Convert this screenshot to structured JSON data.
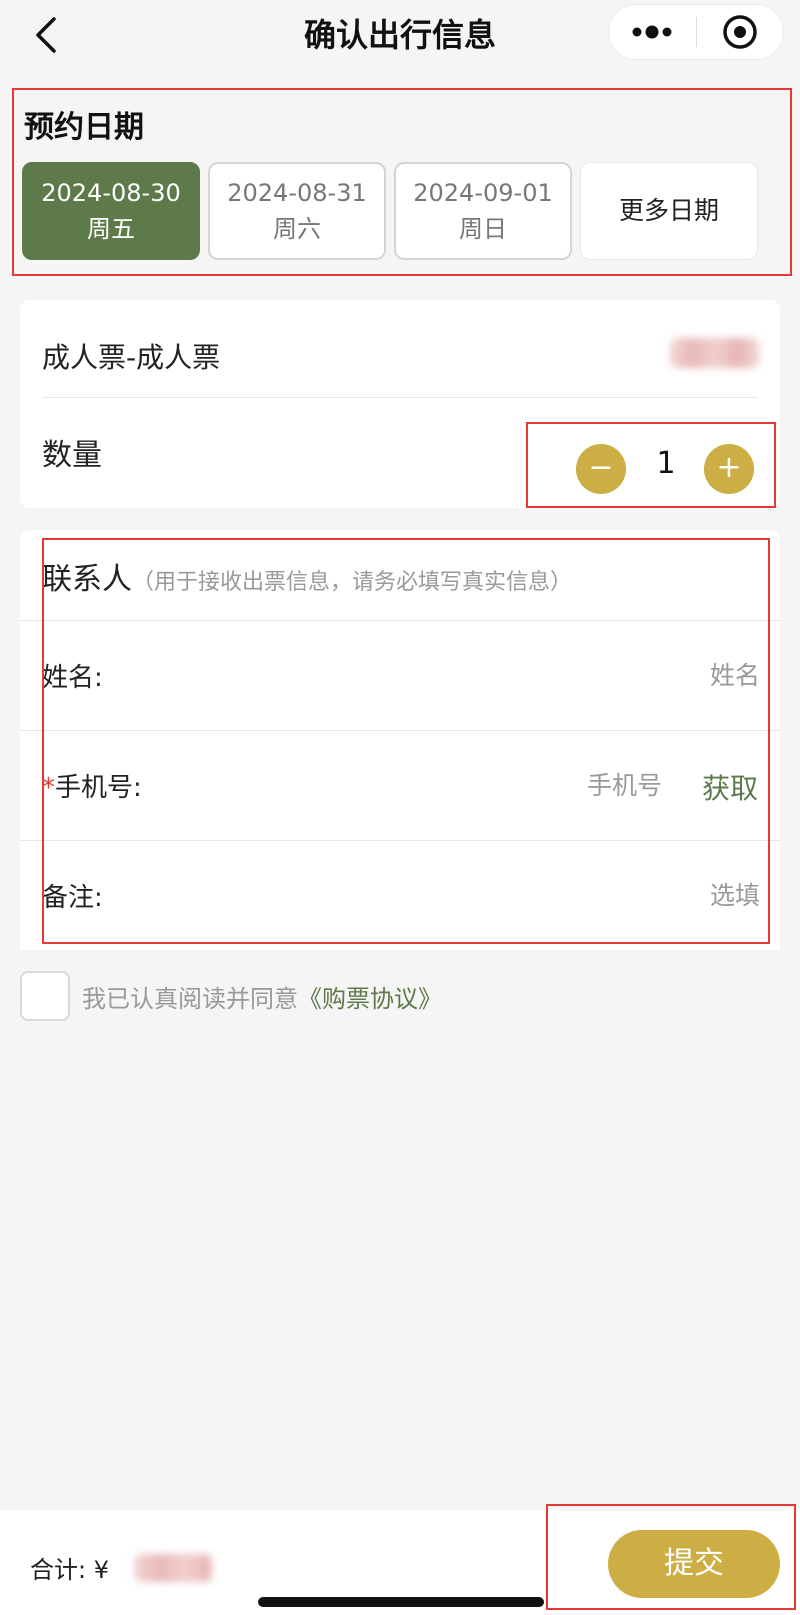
{
  "navbar": {
    "title": "确认出行信息",
    "back_icon": "chevron-left-icon",
    "menu_icon": "more-dots-icon",
    "close_icon": "target-circle-icon"
  },
  "date_section": {
    "title": "预约日期",
    "dates": [
      {
        "date": "2024-08-30",
        "weekday": "周五",
        "selected": true
      },
      {
        "date": "2024-08-31",
        "weekday": "周六",
        "selected": false
      },
      {
        "date": "2024-09-01",
        "weekday": "周日",
        "selected": false
      }
    ],
    "more_label": "更多日期"
  },
  "ticket": {
    "name": "成人票-成人票",
    "quantity_label": "数量",
    "quantity": "1",
    "minus_symbol": "−",
    "plus_symbol": "+"
  },
  "contact": {
    "title": "联系人",
    "hint": "（用于接收出票信息，请务必填写真实信息）",
    "fields": {
      "name": {
        "label": "姓名:",
        "placeholder": "姓名"
      },
      "phone": {
        "label": "手机号:",
        "placeholder": "手机号",
        "action": "获取",
        "required_mark": "*"
      },
      "remark": {
        "label": "备注:",
        "placeholder": "选填"
      }
    }
  },
  "agreement": {
    "text": "我已认真阅读并同意",
    "link": "《购票协议》"
  },
  "bottom": {
    "total_label": "合计: ¥",
    "submit_label": "提交"
  },
  "colors": {
    "accent_green": "#5f7a4a",
    "accent_gold": "#ccae45",
    "highlight_red": "#e53935",
    "background": "#f5f5f5"
  }
}
